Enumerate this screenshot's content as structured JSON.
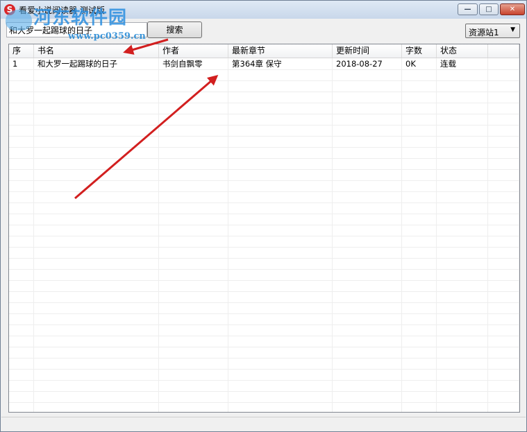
{
  "window": {
    "title": "看爱小说阅读器 测试版",
    "controls": {
      "minimize": "—",
      "maximize": "□",
      "close": "✕"
    }
  },
  "watermark": {
    "name": "河东软件园",
    "url": "www.pc0359.cn"
  },
  "search": {
    "value": "和大罗一起踢球的日子",
    "button_label": "搜索"
  },
  "source": {
    "selected": "资源站1"
  },
  "table": {
    "columns": [
      "序",
      "书名",
      "作者",
      "最新章节",
      "更新时间",
      "字数",
      "状态"
    ],
    "rows": [
      [
        "1",
        "和大罗一起踢球的日子",
        "书剑自飘零",
        "第364章 保守",
        "2018-08-27",
        "0K",
        "连载"
      ]
    ],
    "empty_row_count": 32
  },
  "colors": {
    "arrow": "#d21f1f",
    "titlebar": "#c8d7ea",
    "close_button": "#c8432d"
  }
}
